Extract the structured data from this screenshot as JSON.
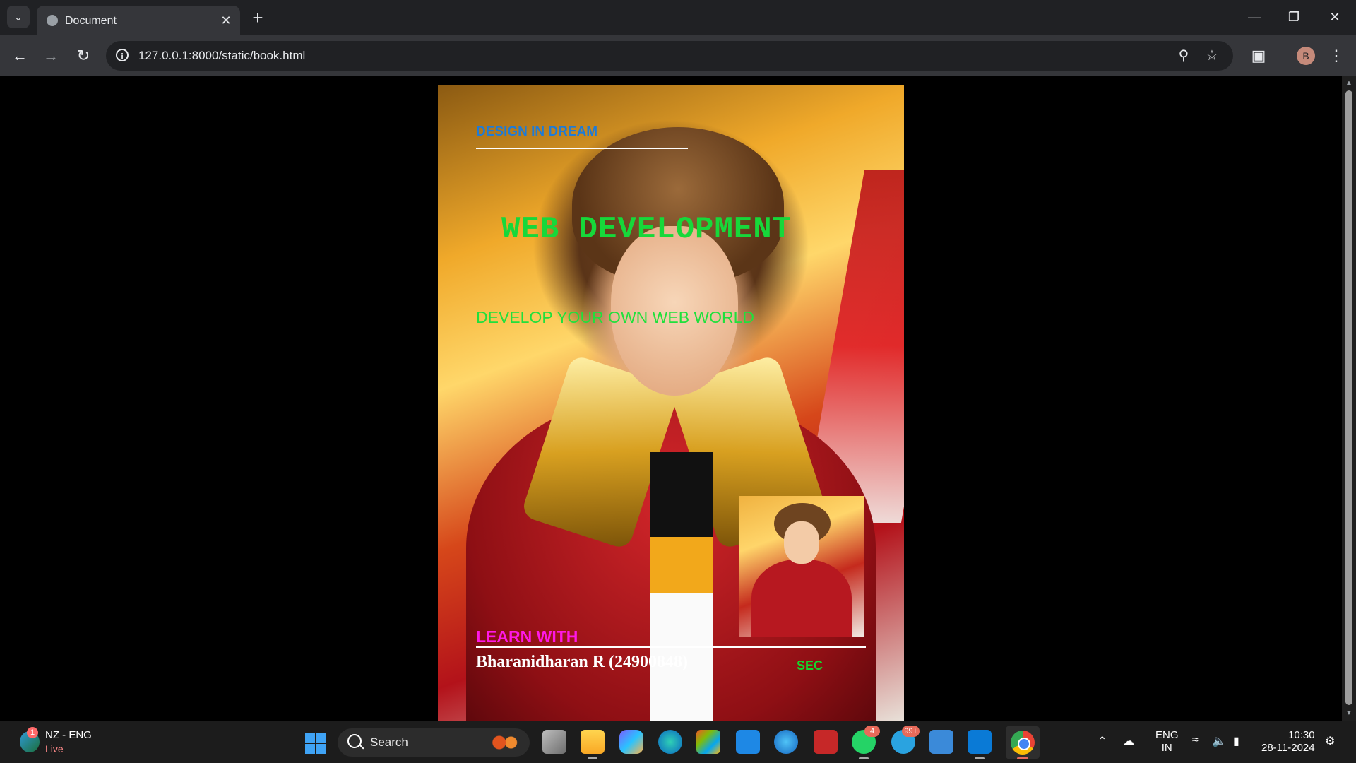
{
  "browser": {
    "tab_title": "Document",
    "url": "127.0.0.1:8000/static/book.html",
    "profile_initial": "B"
  },
  "cover": {
    "series_label": "DESIGN IN DREAM",
    "title": "WEB DEVELOPMENT",
    "subtitle": "DEVELOP YOUR OWN WEB WORLD",
    "learn_with": "LEARN WITH",
    "author": "Bharanidharan R (24900848)",
    "sec_label": "SEC"
  },
  "taskbar": {
    "weather_title": "NZ - ENG",
    "weather_sub": "Live",
    "weather_badge": "1",
    "search_placeholder": "Search",
    "whatsapp_badge": "4",
    "telegram_badge": "99+",
    "lang_line1": "ENG",
    "lang_line2": "IN",
    "time": "10:30",
    "date": "28-11-2024"
  },
  "colors": {
    "series_label": "#1f7bd6",
    "title": "#17d83a",
    "subtitle": "#20e03c",
    "learn_with": "#ff18e6",
    "sec_label": "#14d62c"
  }
}
